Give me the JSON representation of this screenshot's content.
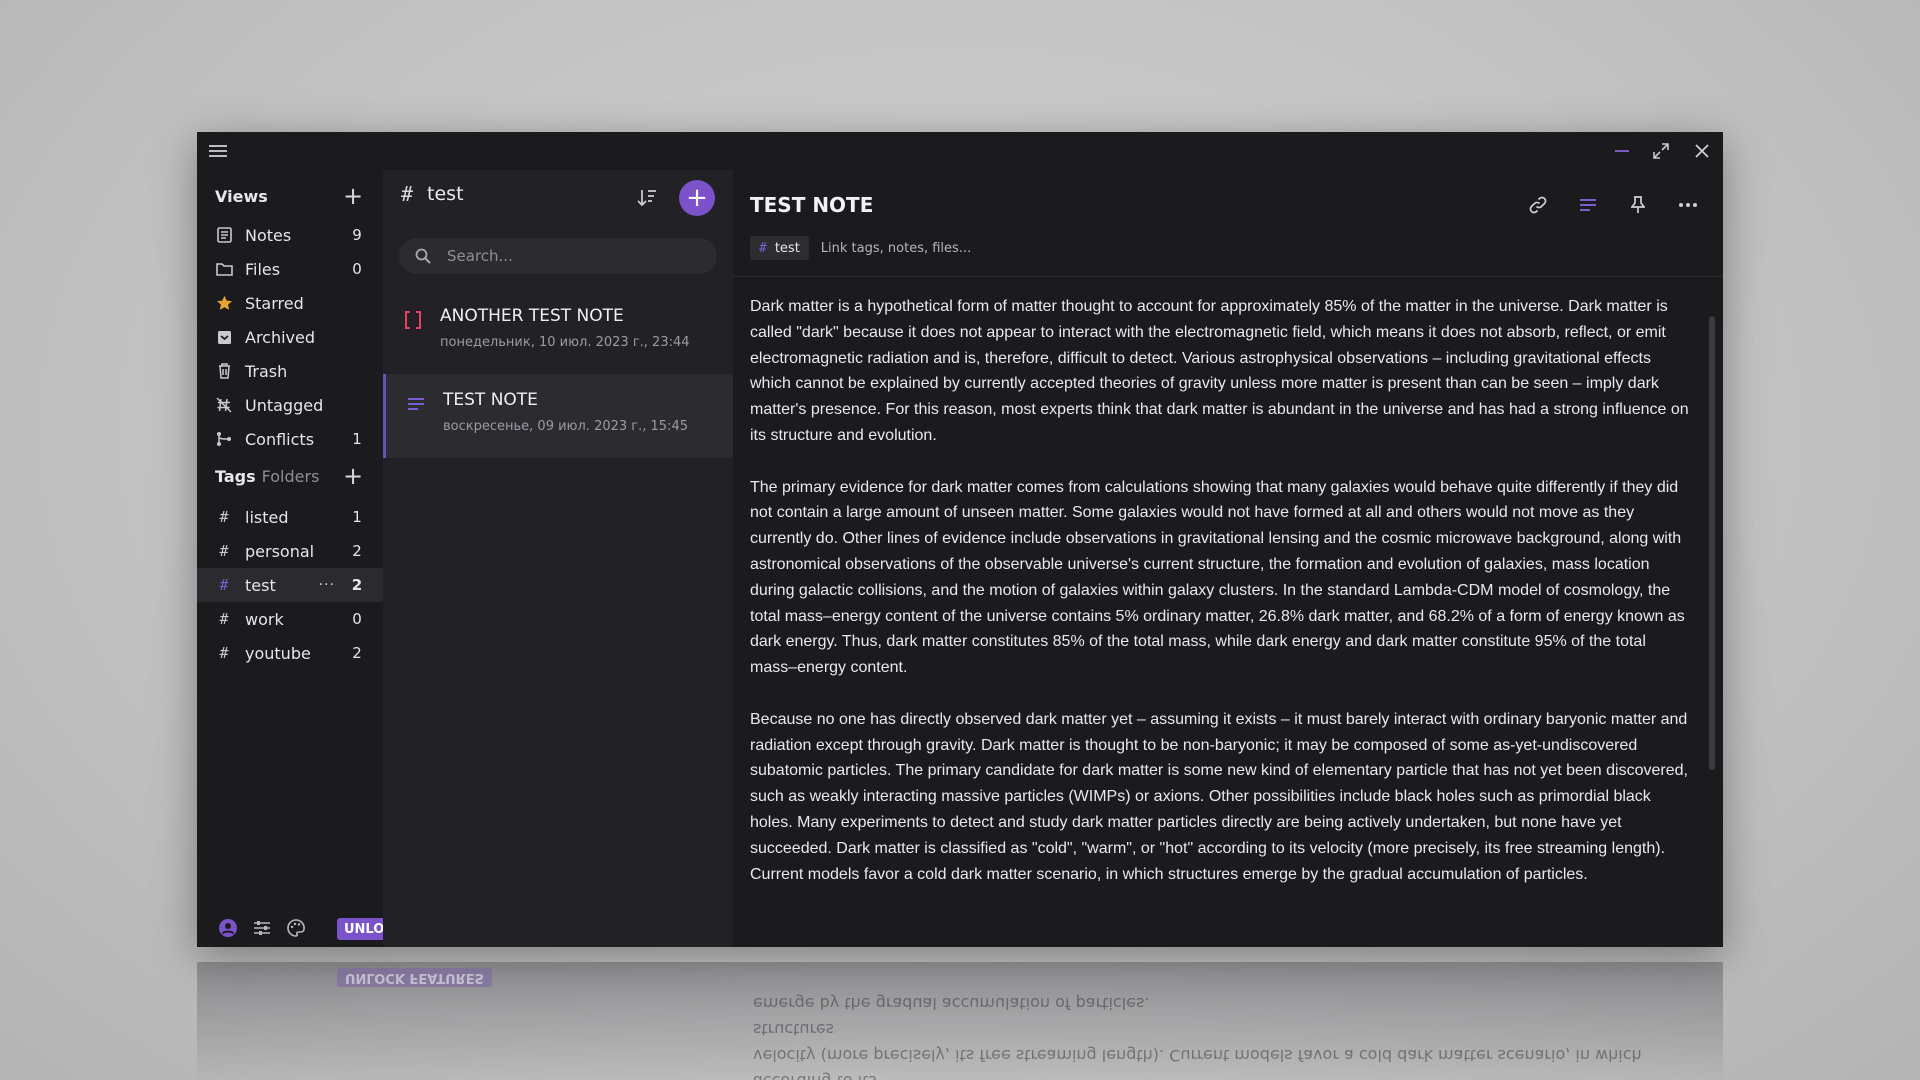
{
  "colors": {
    "accent": "#7b52c9",
    "bg_sidebar": "#1b1b1e",
    "bg_list": "#222226",
    "bg_editor": "#1b1b1e"
  },
  "window": {
    "controls": {
      "minimize": "–",
      "maximize": "⤢",
      "close": "✕"
    }
  },
  "sidebar": {
    "views_heading": "Views",
    "views": [
      {
        "icon": "notes-icon",
        "label": "Notes",
        "count": "9"
      },
      {
        "icon": "folder-icon",
        "label": "Files",
        "count": "0"
      },
      {
        "icon": "star-icon",
        "label": "Starred",
        "count": ""
      },
      {
        "icon": "archive-icon",
        "label": "Archived",
        "count": ""
      },
      {
        "icon": "trash-icon",
        "label": "Trash",
        "count": ""
      },
      {
        "icon": "untagged-icon",
        "label": "Untagged",
        "count": ""
      },
      {
        "icon": "conflicts-icon",
        "label": "Conflicts",
        "count": "1"
      }
    ],
    "tags_heading": "Tags",
    "folders_heading": "Folders",
    "tags": [
      {
        "label": "listed",
        "count": "1"
      },
      {
        "label": "personal",
        "count": "2"
      },
      {
        "label": "test",
        "count": "2",
        "active": true
      },
      {
        "label": "work",
        "count": "0"
      },
      {
        "label": "youtube",
        "count": "2"
      }
    ],
    "more_glyph": "···",
    "unlock_label": "UNLOCK FEATURES"
  },
  "notelist": {
    "title": "test",
    "search_placeholder": "Search...",
    "notes": [
      {
        "title": "ANOTHER TEST NOTE",
        "date": "понедельник, 10 июл. 2023 г., 23:44",
        "icon": "code-brackets-icon"
      },
      {
        "title": "TEST NOTE",
        "date": "воскресенье, 09 июл. 2023 г., 15:45",
        "icon": "text-lines-icon",
        "selected": true
      }
    ]
  },
  "editor": {
    "title": "TEST NOTE",
    "tag": "test",
    "tag_input_placeholder": "Link tags, notes, files...",
    "paragraphs": [
      "Dark matter is a hypothetical form of matter thought to account for approximately 85% of the matter in the universe. Dark matter is called \"dark\" because it does not appear to interact with the electromagnetic field, which means it does not absorb, reflect, or emit electromagnetic radiation and is, therefore, difficult to detect. Various astrophysical observations – including gravitational effects which cannot be explained by currently accepted theories of gravity unless more matter is present than can be seen – imply dark matter's presence. For this reason, most experts think that dark matter is abundant in the universe and has had a strong influence on its structure and evolution.",
      "The primary evidence for dark matter comes from calculations showing that many galaxies would behave quite differently if they did not contain a large amount of unseen matter. Some galaxies would not have formed at all and others would not move as they currently do. Other lines of evidence include observations in gravitational lensing and the cosmic microwave background, along with astronomical observations of the observable universe's current structure, the formation and evolution of galaxies, mass location during galactic collisions, and the motion of galaxies within galaxy clusters. In the standard Lambda-CDM model of cosmology, the total mass–energy content of the universe contains 5% ordinary matter, 26.8% dark matter, and 68.2% of a form of energy known as dark energy. Thus, dark matter constitutes 85% of the total mass, while dark energy and dark matter constitute 95% of the total mass–energy content.",
      "Because no one has directly observed dark matter yet – assuming it exists – it must barely interact with ordinary baryonic matter and radiation except through gravity. Dark matter is thought to be non-baryonic; it may be composed of some as-yet-undiscovered subatomic particles. The primary candidate for dark matter is some new kind of elementary particle that has not yet been discovered, such as weakly interacting massive particles (WIMPs) or axions. Other possibilities include black holes such as primordial black holes. Many experiments to detect and study dark matter particles directly are being actively undertaken, but none have yet succeeded. Dark matter is classified as \"cold\", \"warm\", or \"hot\" according to its velocity (more precisely, its free streaming length). Current models favor a cold dark matter scenario, in which structures emerge by the gradual accumulation of particles."
    ]
  },
  "reflection": {
    "lines": [
      "emerge by the gradual accumulation of particles.",
      "velocity (more precisely, its free streaming length). Current models favor a cold dark matter scenario, in which structures",
      "actively undertaken, but none have yet succeeded. Dark matter is classified as \"cold\", \"warm\", or \"hot\" according to its"
    ]
  }
}
